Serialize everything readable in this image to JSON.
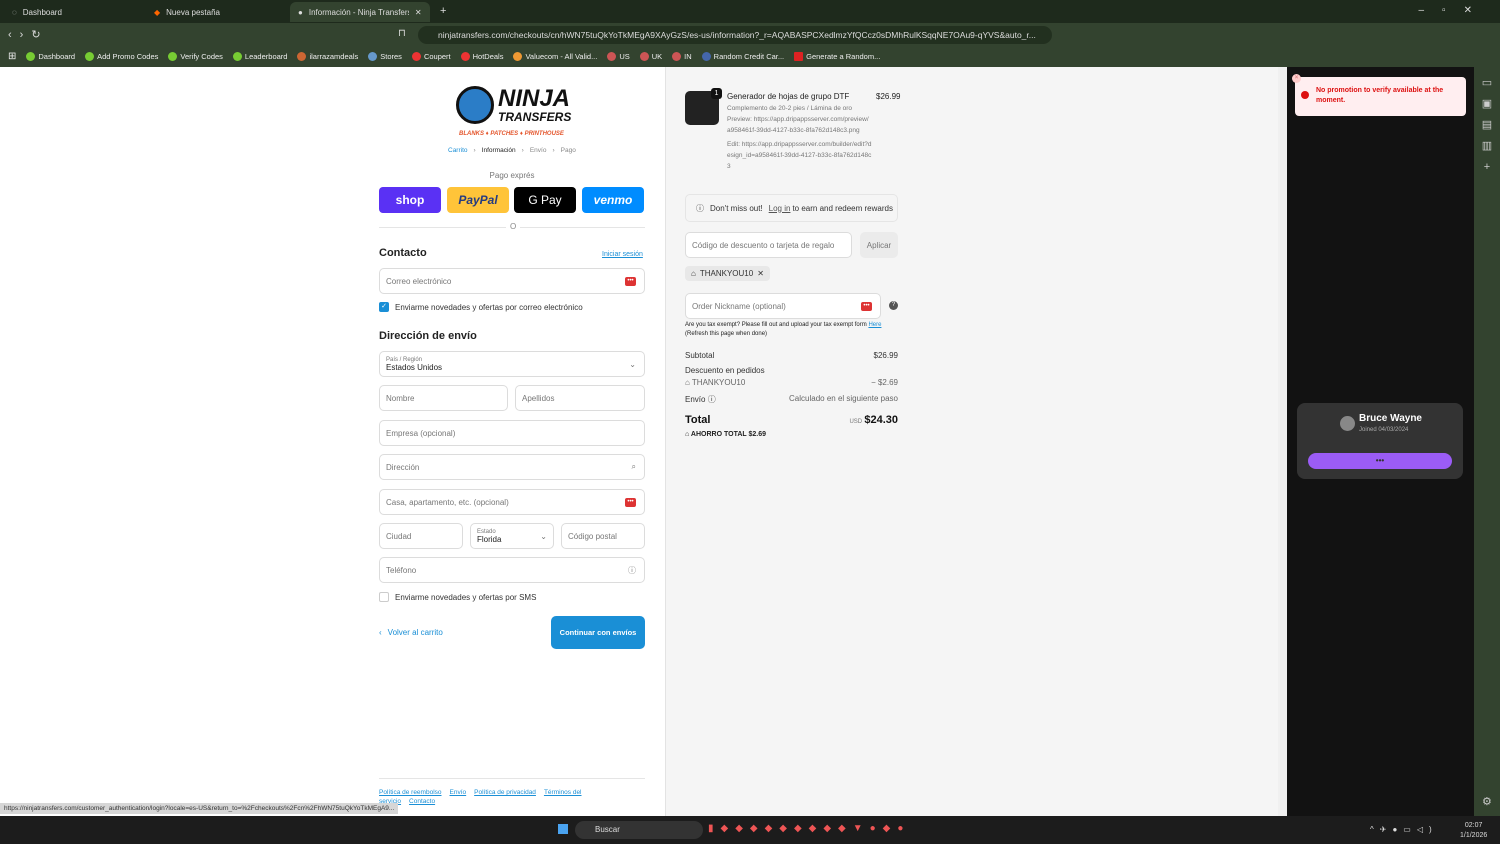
{
  "browser": {
    "tabs": [
      {
        "label": "Dashboard"
      },
      {
        "label": "Nueva pestaña"
      },
      {
        "label": "Información - Ninja Transfers - P"
      }
    ],
    "url": "ninjatransfers.com/checkouts/cn/hWN75tuQkYoTkMEgA9XAyGzS/es-us/information?_r=AQABASPCXedlmzYfQCcz0sDMhRulKSqqNE7OAu9-qYVS&auto_r...",
    "bookmarks": [
      "Dashboard",
      "Add Promo Codes",
      "Verify Codes",
      "Leaderboard",
      "ilarrazamdeals",
      "Stores",
      "Coupert",
      "HotDeals",
      "Valuecom - All Valid...",
      "US",
      "UK",
      "IN",
      "Random Credit Car...",
      "Generate a Random..."
    ],
    "status_url": "https://ninjatransfers.com/customer_authentication/login?locale=es-US&return_to=%2Fcheckouts%2Fcn%2FhWN75tuQkYoTkMEgA9..."
  },
  "checkout": {
    "logo": {
      "line1": "NINJA",
      "line2": "TRANSFERS",
      "tagline": "BLANKS ♦ PATCHES ♦ PRINTHOUSE"
    },
    "breadcrumb": [
      "Carrito",
      "Información",
      "Envío",
      "Pago"
    ],
    "express_label": "Pago exprés",
    "express": [
      "shop",
      "PayPal",
      "G Pay",
      "venmo"
    ],
    "or": "O",
    "contact_title": "Contacto",
    "login_link": "Iniciar sesión",
    "email_placeholder": "Correo electrónico",
    "email_news": "Enviarme novedades y ofertas por correo electrónico",
    "email_news_checked": true,
    "shipping_title": "Dirección de envío",
    "country_label": "País / Región",
    "country": "Estados Unidos",
    "first_name": "Nombre",
    "last_name": "Apellidos",
    "company": "Empresa (opcional)",
    "address": "Dirección",
    "apt": "Casa, apartamento, etc. (opcional)",
    "city": "Ciudad",
    "state_label": "Estado",
    "state": "Florida",
    "zip": "Código postal",
    "phone": "Teléfono",
    "sms": "Enviarme novedades y ofertas por SMS",
    "sms_checked": false,
    "back": "Volver al carrito",
    "continue": "Continuar con envíos",
    "footer": [
      "Política de reembolso",
      "Envío",
      "Política de privacidad",
      "Términos del servicio",
      "Contacto"
    ]
  },
  "summary": {
    "item": {
      "qty": "1",
      "name": "Generador de hojas de grupo DTF",
      "price": "$26.99",
      "variant": "Complemento de 20-2 pies / Lámina de oro",
      "preview": "Preview: https://app.dripappsserver.com/preview/a958461f-39dd-4127-b33c-8fa762d148c3.png",
      "edit": "Edit: https://app.dripappsserver.com/builder/edit?design_id=a958461f-39dd-4127-b33c-8fa762d148c3"
    },
    "rewards": {
      "pre": "Don't miss out!",
      "link": "Log in",
      "post": "to earn and redeem rewards"
    },
    "discount_placeholder": "Código de descuento o tarjeta de regalo",
    "apply": "Aplicar",
    "code": "THANKYOU10",
    "nickname_placeholder": "Order Nickname (optional)",
    "tax_text": "Are you tax exempt? Please fill out and upload your tax exempt form",
    "tax_link": "Here",
    "tax_note": "(Refresh this page when done)",
    "subtotal_label": "Subtotal",
    "subtotal": "$26.99",
    "discount_label": "Descuento en pedidos",
    "discount_code": "THANKYOU10",
    "discount": "− $2.69",
    "shipping_label": "Envío",
    "shipping": "Calculado en el siguiente paso",
    "total_label": "Total",
    "currency": "USD",
    "total": "$24.30",
    "savings": "AHORRO TOTAL  $2.69"
  },
  "extension": {
    "alert": "No promotion to verify available at the moment.",
    "user": "Bruce Wayne",
    "joined": "Joined 04/03/2024",
    "button": "•••"
  },
  "taskbar": {
    "search": "Buscar",
    "time": "02:07",
    "date": "1/1/2026"
  }
}
